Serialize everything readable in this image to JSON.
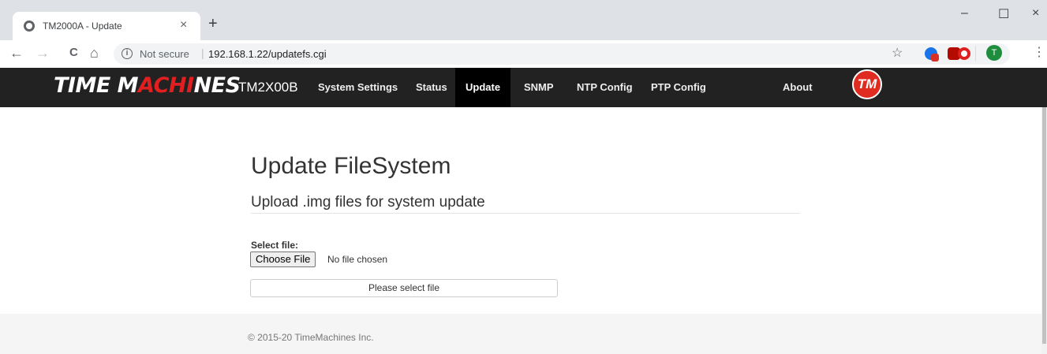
{
  "browser": {
    "tab_title": "TM2000A - Update",
    "tab_close": "×",
    "new_tab": "+",
    "minimize": "–",
    "maximize": "☐",
    "close": "×",
    "back": "←",
    "forward": "→",
    "reload": "C",
    "home": "⌂",
    "info_glyph": "i",
    "not_secure": "Not secure",
    "separator": "|",
    "url": "192.168.1.22/updatefs.cgi",
    "star": "☆",
    "avatar_letter": "T",
    "menu": "⋮"
  },
  "site": {
    "logo_part1": "TIME M",
    "logo_part2": "ACHI",
    "logo_part3": "NES",
    "brand": "TM2X00B",
    "badge": "TM",
    "nav": [
      {
        "label": "System Settings"
      },
      {
        "label": "Status"
      },
      {
        "label": "Update"
      },
      {
        "label": "SNMP"
      },
      {
        "label": "NTP Config"
      },
      {
        "label": "PTP Config"
      },
      {
        "label": "About"
      }
    ]
  },
  "main": {
    "title": "Update FileSystem",
    "subtitle": "Upload .img files for system update",
    "select_label": "Select file:",
    "choose_button": "Choose File",
    "file_status": "No file chosen",
    "submit_label": "Please select file"
  },
  "footer": {
    "copyright": "© 2015-20 TimeMachines Inc."
  },
  "colors": {
    "nav_bg": "#222222",
    "nav_active": "#000000",
    "brand_red": "#e02020"
  }
}
